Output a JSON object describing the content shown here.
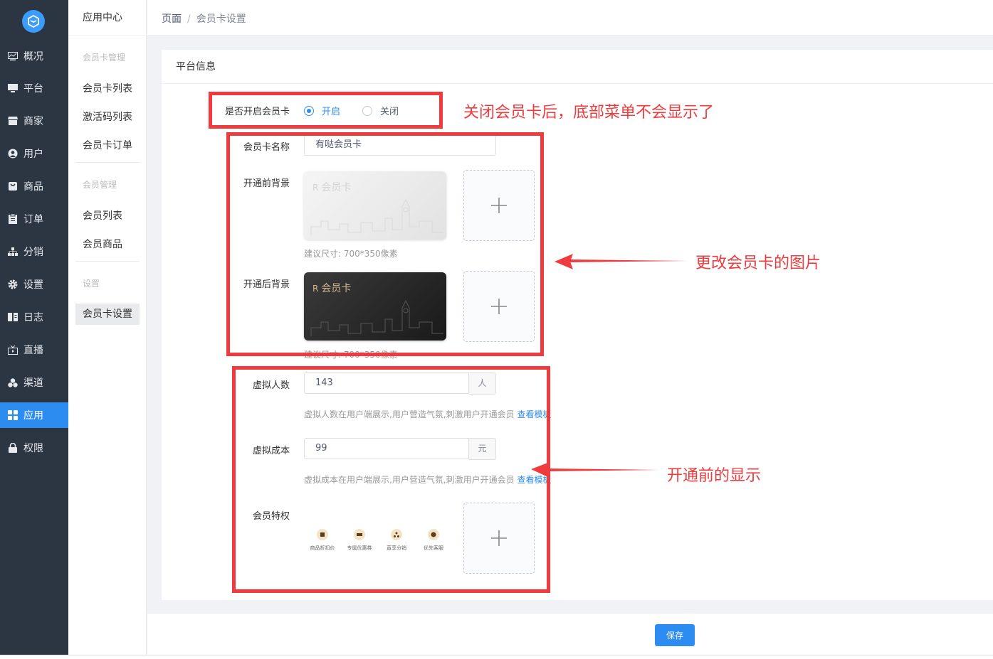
{
  "sidebar": {
    "items": [
      {
        "label": "概况",
        "icon": "chart-icon"
      },
      {
        "label": "平台",
        "icon": "monitor-icon"
      },
      {
        "label": "商家",
        "icon": "store-icon"
      },
      {
        "label": "用户",
        "icon": "user-icon"
      },
      {
        "label": "商品",
        "icon": "bag-icon"
      },
      {
        "label": "订单",
        "icon": "clipboard-icon"
      },
      {
        "label": "分销",
        "icon": "network-icon"
      },
      {
        "label": "设置",
        "icon": "gear-icon"
      },
      {
        "label": "日志",
        "icon": "book-icon"
      },
      {
        "label": "直播",
        "icon": "tv-icon"
      },
      {
        "label": "渠道",
        "icon": "cluster-icon"
      },
      {
        "label": "应用",
        "icon": "grid-icon",
        "active": true
      },
      {
        "label": "权限",
        "icon": "lock-icon"
      }
    ]
  },
  "submenu": {
    "title": "应用中心",
    "group_card": "会员卡管理",
    "card_list": "会员卡列表",
    "code_list": "激活码列表",
    "card_orders": "会员卡订单",
    "group_member": "会员管理",
    "member_list": "会员列表",
    "member_goods": "会员商品",
    "group_settings": "设置",
    "card_settings": "会员卡设置"
  },
  "breadcrumb": {
    "root": "页面",
    "sep": "/",
    "current": "会员卡设置"
  },
  "card": {
    "title": "平台信息"
  },
  "form": {
    "enable_label": "是否开启会员卡",
    "enable_on": "开启",
    "enable_off": "关闭",
    "name_label": "会员卡名称",
    "name_value": "有哒会员卡",
    "before_bg_label": "开通前背景",
    "after_bg_label": "开通后背景",
    "card_face_title": "会员卡",
    "card_logo": "R",
    "size_tip": "建议尺寸: 700*350像素",
    "size_tip_partial": "建议尺寸: 700*350像素",
    "virtual_people_label": "虚拟人数",
    "virtual_people_value": "143",
    "virtual_people_unit": "人",
    "virtual_people_tip": "虚拟人数在用户端展示,用户营造气氛,刺激用户开通会员",
    "view_sample": "查看模板",
    "virtual_cost_label": "虚拟成本",
    "virtual_cost_value": "99",
    "virtual_cost_unit": "元",
    "virtual_cost_tip": "虚拟成本在用户端展示,用户营造气氛,刺激用户开通会员",
    "privilege_label": "会员特权",
    "privileges": [
      "商品折扣价",
      "专属优惠券",
      "直享分销",
      "优先客服"
    ]
  },
  "footer": {
    "save": "保存"
  },
  "annotations": {
    "close_note": "关闭会员卡后，底部菜单不会显示了",
    "image_note": "更改会员卡的图片",
    "before_note": "开通前的显示"
  },
  "colors": {
    "accent": "#2d8cf0",
    "annotation": "#f03b3e",
    "sidebar": "#2c3542"
  }
}
